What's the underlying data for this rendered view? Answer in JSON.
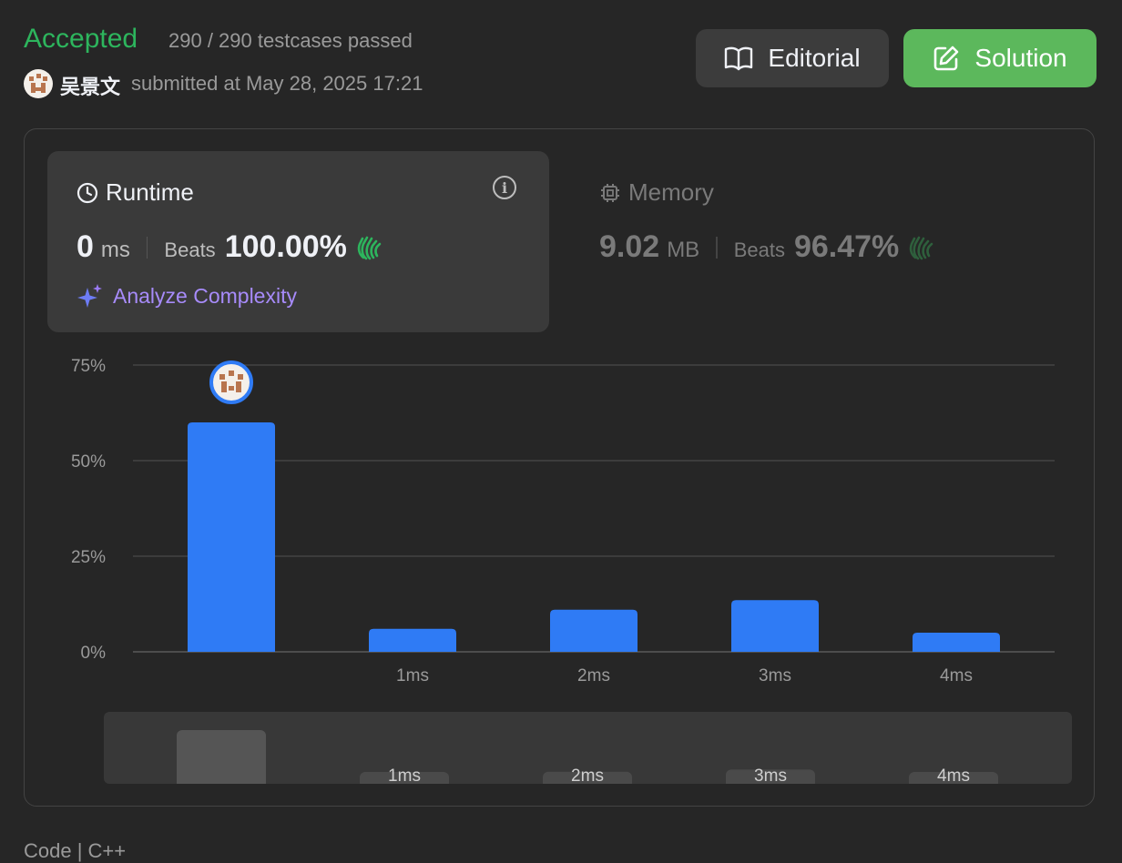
{
  "header": {
    "status": "Accepted",
    "testcases": "290 / 290 testcases passed",
    "username": "吴景文",
    "submitted": "submitted at May 28, 2025 17:21",
    "editorial_label": "Editorial",
    "solution_label": "Solution"
  },
  "runtime": {
    "label": "Runtime",
    "value": "0",
    "unit": "ms",
    "beats_label": "Beats",
    "beats_value": "100.00%",
    "analyze_label": "Analyze Complexity"
  },
  "memory": {
    "label": "Memory",
    "value": "9.02",
    "unit": "MB",
    "beats_label": "Beats",
    "beats_value": "96.47%"
  },
  "colors": {
    "accepted": "#2db55d",
    "bar": "#2f7bf5",
    "solution_button": "#5cb85c",
    "analyze": "#a78bfa"
  },
  "chart_data": {
    "type": "bar",
    "categories": [
      "",
      "1ms",
      "2ms",
      "3ms",
      "4ms"
    ],
    "values": [
      60,
      6,
      11,
      13.5,
      5
    ],
    "yticks": [
      "0%",
      "25%",
      "50%",
      "75%"
    ],
    "ylim": [
      0,
      75
    ],
    "highlight_index": 0,
    "grid": true
  },
  "minimap": {
    "labels": [
      "1ms",
      "2ms",
      "3ms",
      "4ms"
    ]
  },
  "footer_partial": "Code | C++"
}
